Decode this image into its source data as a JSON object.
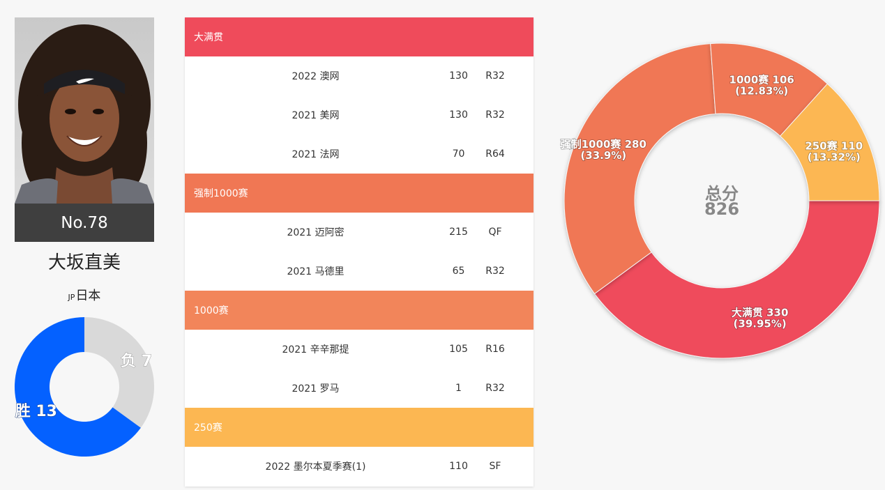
{
  "player": {
    "rank": "No.78",
    "name": "大坂直美",
    "country_code": "JP",
    "country": "日本"
  },
  "colors": {
    "grand_slam": "#ef4b5b",
    "mandatory_1000": "#f07754",
    "premier_1000": "#f2855a",
    "premier_250": "#fcb752",
    "wins": "#0461ff",
    "losses": "#d9d9d9"
  },
  "table": {
    "sections": [
      {
        "label": "大满贯",
        "color": "#ef4b5b",
        "rows": [
          {
            "event": "2022 澳网",
            "points": "130",
            "round": "R32"
          },
          {
            "event": "2021 美网",
            "points": "130",
            "round": "R32"
          },
          {
            "event": "2021 法网",
            "points": "70",
            "round": "R64"
          }
        ]
      },
      {
        "label": "强制1000赛",
        "color": "#f07754",
        "rows": [
          {
            "event": "2021 迈阿密",
            "points": "215",
            "round": "QF"
          },
          {
            "event": "2021 马德里",
            "points": "65",
            "round": "R32"
          }
        ]
      },
      {
        "label": "1000赛",
        "color": "#f2855a",
        "rows": [
          {
            "event": "2021 辛辛那提",
            "points": "105",
            "round": "R16"
          },
          {
            "event": "2021 罗马",
            "points": "1",
            "round": "R32"
          }
        ]
      },
      {
        "label": "250赛",
        "color": "#fcb752",
        "rows": [
          {
            "event": "2022 墨尔本夏季赛(1)",
            "points": "110",
            "round": "SF"
          }
        ]
      }
    ]
  },
  "chart_data": [
    {
      "type": "pie",
      "variant": "donut",
      "categories": [
        "胜",
        "负"
      ],
      "values": [
        13,
        7
      ],
      "labels": [
        "胜 13",
        "负 7"
      ],
      "colors": [
        "#0461ff",
        "#d9d9d9"
      ]
    },
    {
      "type": "pie",
      "variant": "donut",
      "center_label": "总分",
      "center_value": "826",
      "categories": [
        "大满贯",
        "强制1000赛",
        "1000赛",
        "250赛"
      ],
      "values": [
        330,
        280,
        106,
        110
      ],
      "labels": [
        "大满贯 330",
        "强制1000赛 280",
        "1000赛 106",
        "250赛 110"
      ],
      "percent_labels": [
        "(39.95%)",
        "(33.9%)",
        "(12.83%)",
        "(13.32%)"
      ],
      "colors": [
        "#ef4b5b",
        "#f07754",
        "#f07754",
        "#fcb752"
      ]
    }
  ]
}
